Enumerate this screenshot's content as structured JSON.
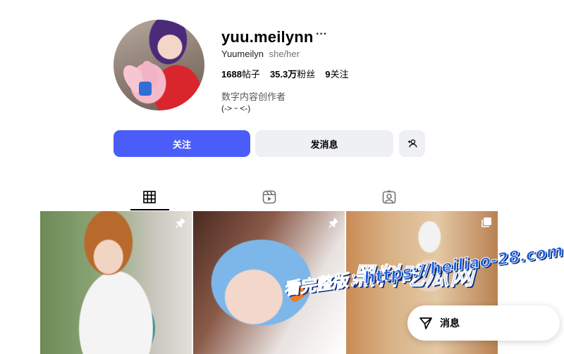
{
  "profile": {
    "username": "yuu.meilynn",
    "display_name": "Yuumeilyn",
    "pronouns": "she/her",
    "stats": {
      "posts_count": "1688",
      "posts_label": "帖子",
      "followers_count": "35.3万",
      "followers_label": "粉丝",
      "following_count": "9",
      "following_label": "关注"
    },
    "category": "数字内容创作者",
    "bio": "(-> ᵕ <-)"
  },
  "actions": {
    "follow_label": "关注",
    "message_label": "发消息"
  },
  "tabs": [
    "grid",
    "reels",
    "tagged"
  ],
  "icons": {
    "more": "more-horizontal-icon",
    "add_friend": "person-add-icon",
    "grid": "grid-icon",
    "reels": "reels-icon",
    "tagged": "tagged-icon",
    "pin": "pin-icon",
    "multi": "carousel-icon",
    "send": "send-icon"
  },
  "posts": [
    {
      "badge": "pin-icon"
    },
    {
      "badge": "pin-icon"
    },
    {
      "badge": "carousel-icon"
    }
  ],
  "floating_message": {
    "label": "消息"
  },
  "watermark": {
    "logo_text": "黑料吃瓜网",
    "url_text": "看完整版：https://heiliao-28.com"
  },
  "colors": {
    "follow_button": "#4a5df9",
    "secondary_button": "#eff0f3",
    "watermark": "#1d5fe0"
  }
}
